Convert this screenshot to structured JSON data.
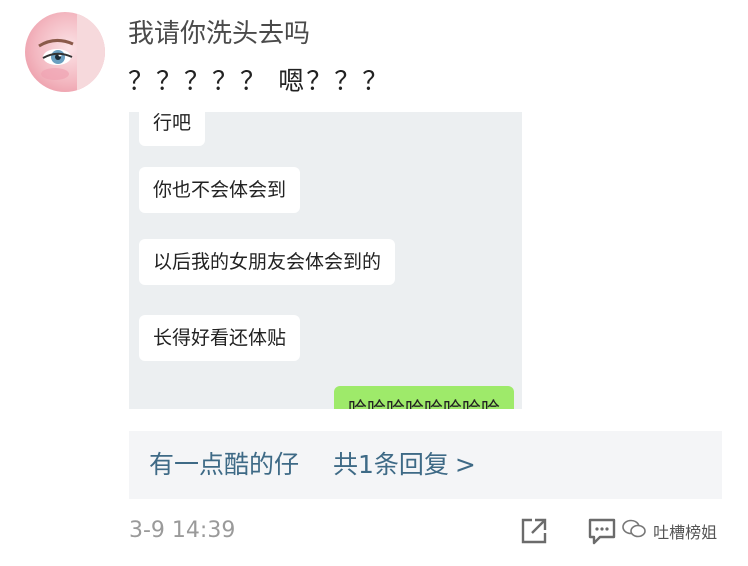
{
  "post": {
    "username": "我请你洗头去吗",
    "text": "？？？？？ 嗯？？？",
    "avatar_icon": "avatar-girl-icon"
  },
  "screenshot": {
    "messages": [
      {
        "text": "行吧",
        "side": "left"
      },
      {
        "text": "你也不会体会到",
        "side": "left"
      },
      {
        "text": "以后我的女朋友会体会到的",
        "side": "left"
      },
      {
        "text": "长得好看还体贴",
        "side": "left"
      },
      {
        "text": "哈哈哈哈哈哈哈哈",
        "side": "right"
      }
    ]
  },
  "reply": {
    "author": "有一点酷的仔",
    "count_label": "共1条回复",
    "chevron": ">"
  },
  "footer": {
    "timestamp": "3-9 14:39",
    "watermark": "吐槽榜姐"
  },
  "colors": {
    "reply_link": "#3e6a86",
    "chat_bg": "#eceff1",
    "green_bubble": "#9eea6a"
  }
}
